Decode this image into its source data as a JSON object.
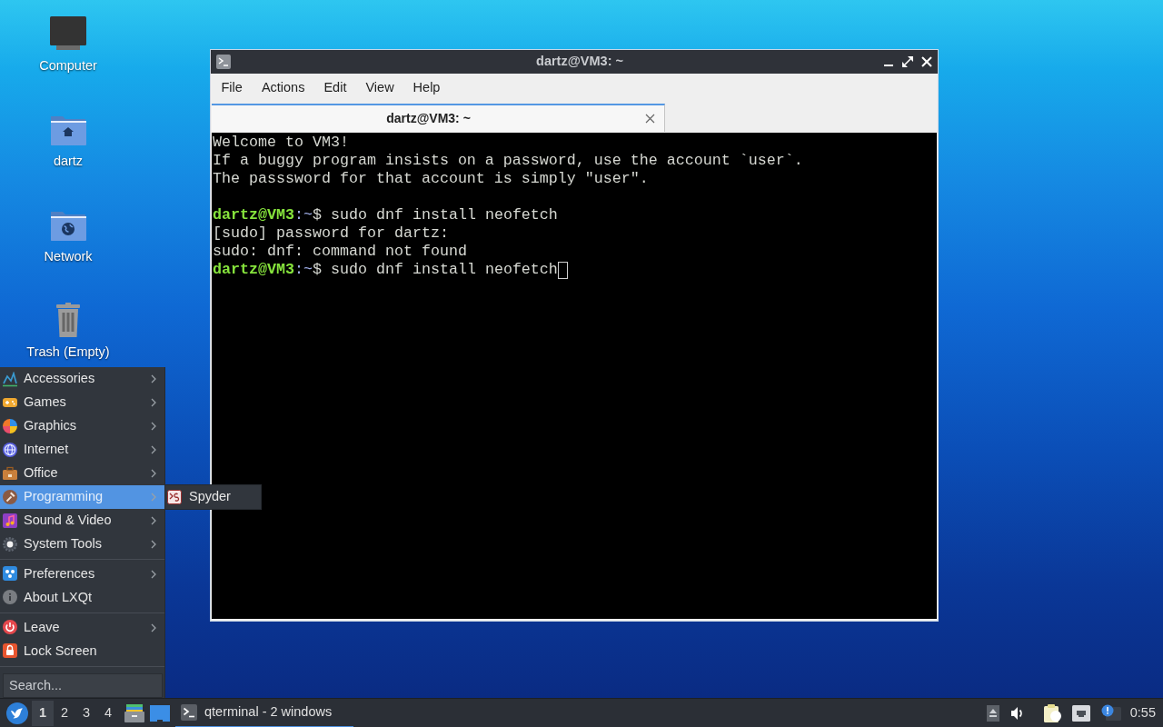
{
  "desktop_icons": [
    {
      "label": "Computer"
    },
    {
      "label": "dartz"
    },
    {
      "label": "Network"
    },
    {
      "label": "Trash (Empty)"
    }
  ],
  "window": {
    "title": "dartz@VM3: ~",
    "menu": [
      "File",
      "Actions",
      "Edit",
      "View",
      "Help"
    ],
    "tabs": [
      {
        "label": "dartz@VM3: ~",
        "selected": true
      }
    ],
    "terminal": {
      "lines": [
        {
          "kind": "output",
          "text": "Welcome to VM3!"
        },
        {
          "kind": "output",
          "text": "If a buggy program insists on a password, use the account `user`."
        },
        {
          "kind": "output",
          "text": "The passsword for that account is simply \"user\"."
        },
        {
          "kind": "blank"
        },
        {
          "kind": "prompt",
          "user": "dartz@VM3",
          "path": ":~",
          "symbol": "$",
          "command": "sudo dnf install neofetch"
        },
        {
          "kind": "output",
          "text": "[sudo] password for dartz:"
        },
        {
          "kind": "output",
          "text": "sudo: dnf: command not found"
        },
        {
          "kind": "prompt",
          "user": "dartz@VM3",
          "path": ":~",
          "symbol": "$",
          "command": "sudo dnf install neofetch"
        }
      ],
      "cursor": true
    }
  },
  "start_menu": {
    "sections": [
      {
        "items": [
          {
            "label": "Accessories",
            "submenu": true,
            "selected": false
          },
          {
            "label": "Games",
            "submenu": true,
            "selected": false
          },
          {
            "label": "Graphics",
            "submenu": true,
            "selected": false
          },
          {
            "label": "Internet",
            "submenu": true,
            "selected": false
          },
          {
            "label": "Office",
            "submenu": true,
            "selected": false
          },
          {
            "label": "Programming",
            "submenu": true,
            "selected": true
          },
          {
            "label": "Sound & Video",
            "submenu": true,
            "selected": false
          },
          {
            "label": "System Tools",
            "submenu": true,
            "selected": false
          }
        ]
      },
      {
        "items": [
          {
            "label": "Preferences",
            "submenu": true,
            "selected": false
          },
          {
            "label": "About LXQt",
            "submenu": false,
            "selected": false
          }
        ]
      },
      {
        "items": [
          {
            "label": "Leave",
            "submenu": true,
            "selected": false
          },
          {
            "label": "Lock Screen",
            "submenu": false,
            "selected": false
          }
        ]
      }
    ],
    "open_submenu": [
      {
        "label": "Spyder"
      }
    ],
    "search": {
      "placeholder": "Search..."
    }
  },
  "taskbar": {
    "desktops": [
      {
        "label": "1",
        "selected": true
      },
      {
        "label": "2",
        "selected": false
      },
      {
        "label": "3",
        "selected": false
      },
      {
        "label": "4",
        "selected": false
      }
    ],
    "tasks": [
      {
        "label": "qterminal - 2 windows",
        "selected": true
      }
    ],
    "clock": "0:55"
  }
}
